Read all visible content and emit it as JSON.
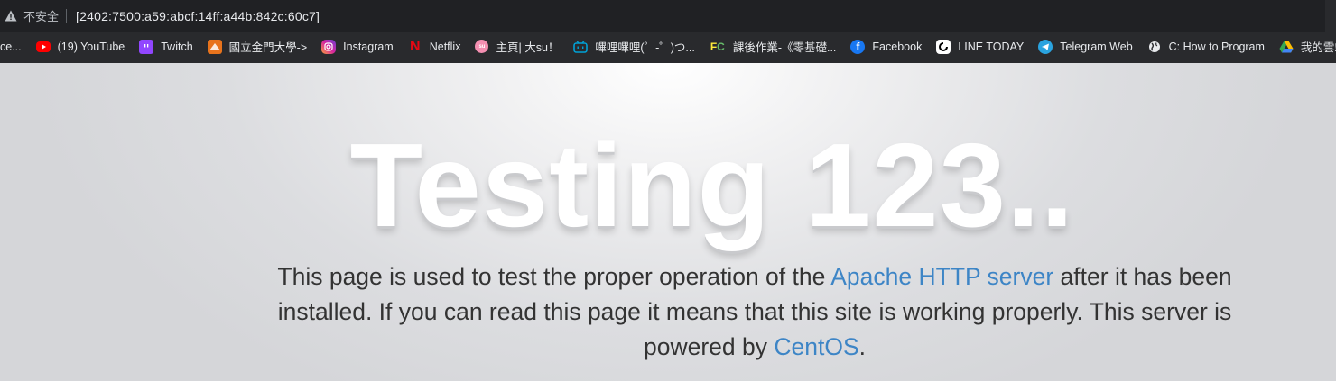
{
  "addressbar": {
    "security_label": "不安全",
    "url": "[2402:7500:a59:abcf:14ff:a44b:842c:60c7]"
  },
  "bookmarks": [
    {
      "label": "ce...",
      "icon": "truncated-bookmark-icon",
      "color": ""
    },
    {
      "label": "(19) YouTube",
      "icon": "youtube-icon",
      "color": "#ff0000"
    },
    {
      "label": "Twitch",
      "icon": "twitch-icon",
      "color": "#9146ff"
    },
    {
      "label": "國立金門大學->",
      "icon": "nqu-icon",
      "color": "#e8731c"
    },
    {
      "label": "Instagram",
      "icon": "instagram-icon",
      "color": "#d6249f"
    },
    {
      "label": "Netflix",
      "icon": "netflix-icon",
      "color": "#e50914"
    },
    {
      "label": "主頁| 大su！",
      "icon": "pink-avatar-icon",
      "color": "#f48fb1"
    },
    {
      "label": "嗶哩嗶哩(゜-゜)つ...",
      "icon": "bilibili-icon",
      "color": "#00a1d6"
    },
    {
      "label": "課後作業-《零基礎...",
      "icon": "fc-icon",
      "color": "#c62828"
    },
    {
      "label": "Facebook",
      "icon": "facebook-icon",
      "color": "#1877f2"
    },
    {
      "label": "LINE TODAY",
      "icon": "line-today-icon",
      "color": "#ffffff"
    },
    {
      "label": "Telegram Web",
      "icon": "telegram-icon",
      "color": "#2aa3df"
    },
    {
      "label": "C: How to Program",
      "icon": "globe-icon",
      "color": "#ffffff"
    },
    {
      "label": "我的雲端",
      "icon": "google-drive-icon",
      "color": "#34a853"
    }
  ],
  "page": {
    "title": "Testing 123..",
    "desc_part1": "This page is used to test the proper operation of the ",
    "link1": "Apache HTTP server",
    "desc_part2": " after it has been installed. If you can read this page it means that this site is working properly. This server is powered by ",
    "link2": "CentOS",
    "desc_part3": ".",
    "link_color": "#3d85c6"
  }
}
